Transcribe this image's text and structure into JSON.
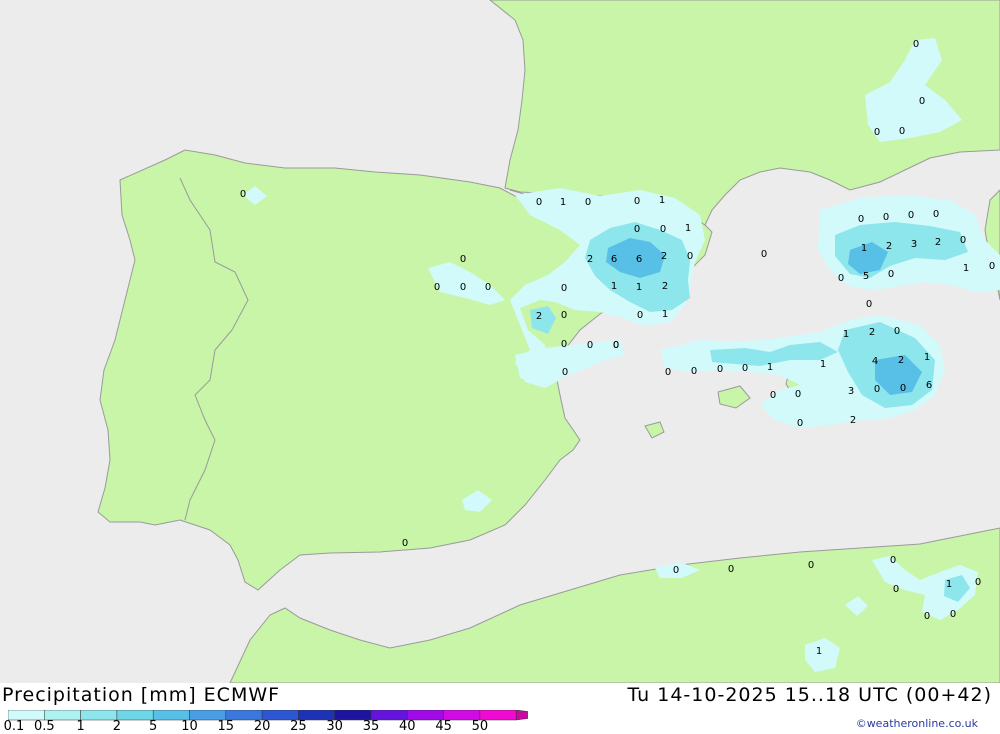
{
  "header": {
    "title": "Precipitation [mm] ECMWF",
    "datetime": "Tu 14-10-2025 15..18 UTC (00+42)"
  },
  "credit": "©weatheronline.co.uk",
  "colors": {
    "sea": "#ececec",
    "land": "#c8f5a8",
    "coast": "#9a9a9a"
  },
  "legend": {
    "ticks": [
      "0.1",
      "0.5",
      "1",
      "2",
      "5",
      "10",
      "15",
      "20",
      "25",
      "30",
      "35",
      "40",
      "45",
      "50"
    ],
    "colors": [
      "#d2fafa",
      "#aff0f0",
      "#8ce6ec",
      "#6ed6e6",
      "#58bfe6",
      "#4a9ee6",
      "#3a78dc",
      "#2d56d2",
      "#1e32b4",
      "#1e14a0",
      "#6414dc",
      "#a00ae6",
      "#d20ae6",
      "#f00ad2",
      "#c80aa0"
    ]
  },
  "map": {
    "value_labels": [
      {
        "t": "0"
      },
      {
        "t": "0"
      },
      {
        "t": "0"
      },
      {
        "t": "0"
      },
      {
        "t": "0"
      },
      {
        "t": "0"
      },
      {
        "t": "0"
      },
      {
        "t": "1"
      },
      {
        "t": "0"
      },
      {
        "t": "0"
      },
      {
        "t": "1"
      },
      {
        "t": "0"
      },
      {
        "t": "0"
      },
      {
        "t": "1"
      },
      {
        "t": "2"
      },
      {
        "t": "6"
      },
      {
        "t": "6"
      },
      {
        "t": "2"
      },
      {
        "t": "0"
      },
      {
        "t": "0"
      },
      {
        "t": "0"
      },
      {
        "t": "0"
      },
      {
        "t": "0"
      },
      {
        "t": "0"
      },
      {
        "t": "1"
      },
      {
        "t": "1"
      },
      {
        "t": "2"
      },
      {
        "t": "2"
      },
      {
        "t": "0"
      },
      {
        "t": "0"
      },
      {
        "t": "1"
      },
      {
        "t": "0"
      },
      {
        "t": "0"
      },
      {
        "t": "0"
      },
      {
        "t": "0"
      },
      {
        "t": "0"
      },
      {
        "t": "0"
      },
      {
        "t": "0"
      },
      {
        "t": "0"
      },
      {
        "t": "0"
      },
      {
        "t": "1"
      },
      {
        "t": "2"
      },
      {
        "t": "3"
      },
      {
        "t": "2"
      },
      {
        "t": "0"
      },
      {
        "t": "0"
      },
      {
        "t": "5"
      },
      {
        "t": "0"
      },
      {
        "t": "1"
      },
      {
        "t": "0"
      },
      {
        "t": "0"
      },
      {
        "t": "1"
      },
      {
        "t": "2"
      },
      {
        "t": "0"
      },
      {
        "t": "4"
      },
      {
        "t": "2"
      },
      {
        "t": "1"
      },
      {
        "t": "0"
      },
      {
        "t": "0"
      },
      {
        "t": "1"
      },
      {
        "t": "1"
      },
      {
        "t": "0"
      },
      {
        "t": "0"
      },
      {
        "t": "0"
      },
      {
        "t": "3"
      },
      {
        "t": "0"
      },
      {
        "t": "0"
      },
      {
        "t": "6"
      },
      {
        "t": "2"
      },
      {
        "t": "0"
      },
      {
        "t": "0"
      },
      {
        "t": "0"
      },
      {
        "t": "0"
      },
      {
        "t": "0"
      },
      {
        "t": "0"
      },
      {
        "t": "0"
      },
      {
        "t": "0"
      },
      {
        "t": "1"
      },
      {
        "t": "0"
      },
      {
        "t": "0"
      },
      {
        "t": "0"
      },
      {
        "t": "1"
      }
    ]
  }
}
